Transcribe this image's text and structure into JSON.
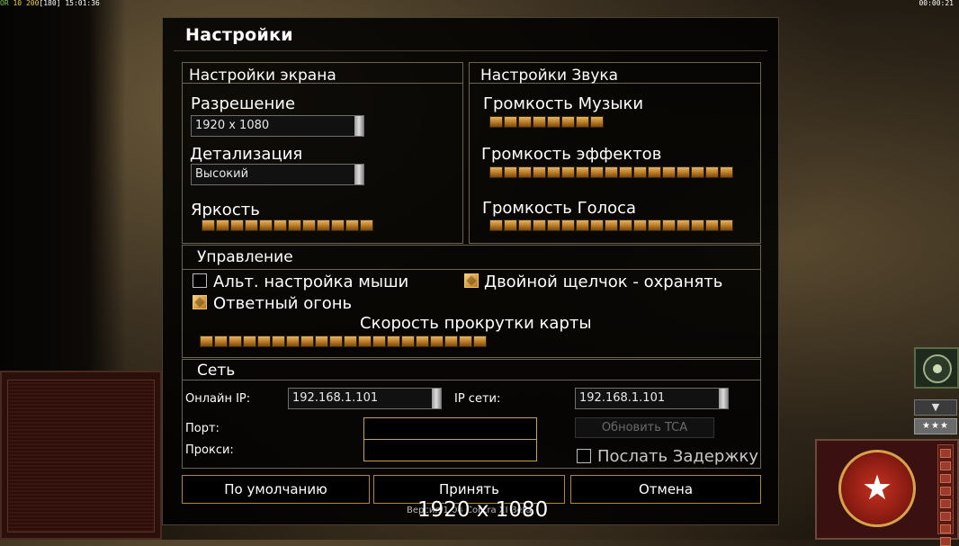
{
  "hud": {
    "prefix": "OR",
    "stat1": "10",
    "stat2": "200",
    "stat3": "[180]",
    "time": "15:01:36",
    "timer": "00:00:21"
  },
  "side": {
    "stars": "★★★",
    "down": "▼",
    "emblem": "★"
  },
  "dialog": {
    "title": "Настройки",
    "screen": {
      "section": "Настройки экрана",
      "resolution_label": "Разрешение",
      "resolution_value": "1920 x 1080",
      "detail_label": "Детализация",
      "detail_value": "Высокий",
      "brightness_label": "Яркость",
      "brightness_level": 12
    },
    "sound": {
      "section": "Настройки Звука",
      "music_label": "Громкость Музыки",
      "music_level": 8,
      "effects_label": "Громкость эффектов",
      "effects_level": 17,
      "voice_label": "Громкость Голоса",
      "voice_level": 17
    },
    "control": {
      "section": "Управление",
      "alt_mouse_label": "Альт. настройка мыши",
      "alt_mouse_checked": false,
      "double_click_label": "Двойной щелчок - охранять",
      "double_click_checked": true,
      "return_fire_label": "Ответный огонь",
      "return_fire_checked": true,
      "scroll_label": "Скорость прокрутки карты",
      "scroll_level": 20
    },
    "network": {
      "section": "Сеть",
      "online_ip_label": "Онлайн IP:",
      "online_ip_value": "192.168.1.101",
      "lan_ip_label": "IP сети:",
      "lan_ip_value": "192.168.1.101",
      "port_label": "Порт:",
      "proxy_label": "Прокси:",
      "update_tca": "Обновить TCA",
      "send_delay_label": "Послать Задержку",
      "send_delay_checked": false
    },
    "buttons": {
      "default": "По умолчанию",
      "accept": "Принять",
      "cancel": "Отмена"
    },
    "version_text": "Версия 1.04 Contra XI Beta",
    "overlay_resolution": "1920 x 1080"
  }
}
